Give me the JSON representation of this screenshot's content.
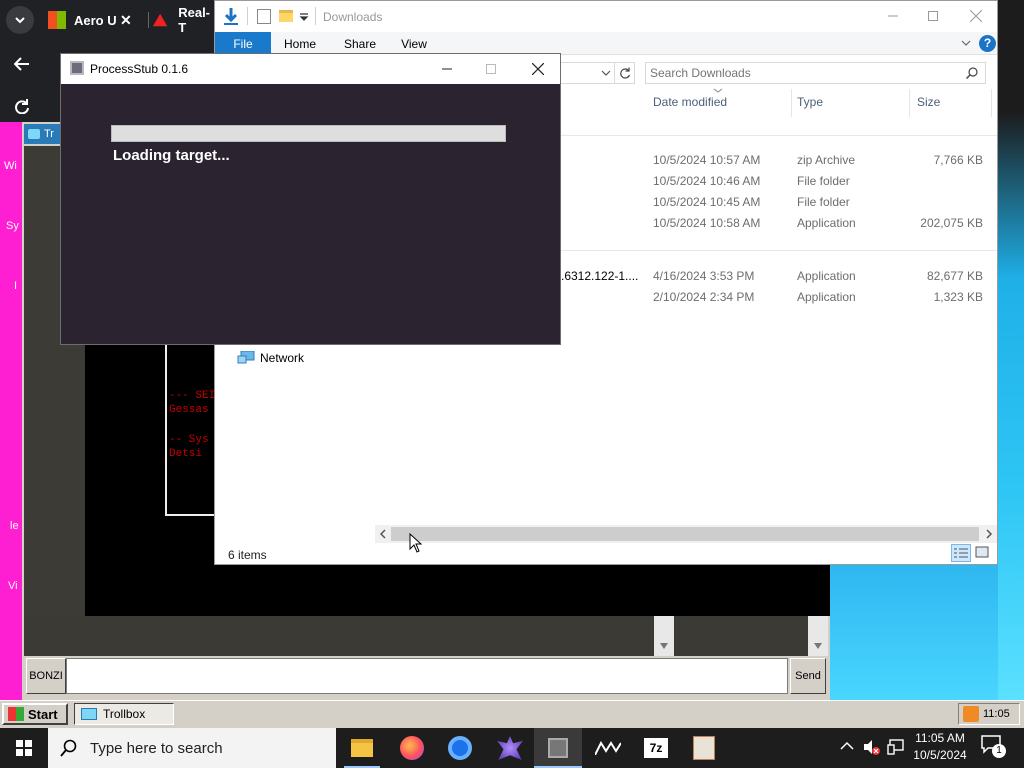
{
  "browser": {
    "tabs": [
      {
        "label": "Aero U"
      },
      {
        "label": "Real-T"
      }
    ]
  },
  "vm": {
    "window_tab_label": "Tr",
    "left_labels": [
      "Wi",
      "Sy",
      "I",
      "le",
      "Vi"
    ],
    "console_lines": [
      "--- SEI",
      "Gessas",
      "-- Sys",
      "Detsi"
    ],
    "chat": {
      "name_label": "BONZI",
      "input_value": "",
      "send_label": "Send"
    },
    "xp_taskbar": {
      "start_label": "Start",
      "task_label": "Trollbox",
      "tray_time": "11:05"
    }
  },
  "explorer": {
    "path_label": "Downloads",
    "ribbon_tabs": [
      {
        "label": "File"
      },
      {
        "label": "Home"
      },
      {
        "label": "Share"
      },
      {
        "label": "View"
      }
    ],
    "search_placeholder": "Search Downloads",
    "columns": {
      "date": "Date modified",
      "type": "Type",
      "size": "Size"
    },
    "rows": [
      {
        "name": "",
        "date": "10/5/2024 10:57 AM",
        "type": "zip Archive",
        "size": "7,766 KB"
      },
      {
        "name": "",
        "date": "10/5/2024 10:46 AM",
        "type": "File folder",
        "size": ""
      },
      {
        "name": "",
        "date": "10/5/2024 10:45 AM",
        "type": "File folder",
        "size": ""
      },
      {
        "name": "",
        "date": "10/5/2024 10:58 AM",
        "type": "Application",
        "size": "202,075 KB"
      },
      {
        "name": ".6312.122-1....",
        "date": "4/16/2024 3:53 PM",
        "type": "Application",
        "size": "82,677 KB"
      },
      {
        "name": "",
        "date": "2/10/2024 2:34 PM",
        "type": "Application",
        "size": "1,323 KB"
      }
    ],
    "nav_network_label": "Network",
    "status_items": "6 items"
  },
  "processstub": {
    "title": "ProcessStub 0.1.6",
    "status_text": "Loading target...",
    "progress": 0
  },
  "taskbar": {
    "search_placeholder": "Type here to search",
    "clock_time": "11:05 AM",
    "clock_date": "10/5/2024",
    "notification_count": "1"
  },
  "colors": {
    "ribbon_file": "#1979ca",
    "pstub_bg": "#2b2330",
    "vm_pink": "#ff1fd2",
    "help_blue": "#1c74c8"
  }
}
